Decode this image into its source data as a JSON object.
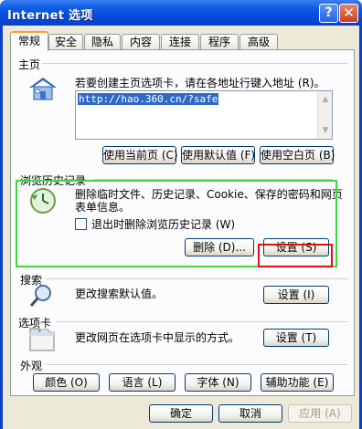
{
  "window": {
    "title": "Internet 选项",
    "help_label": "?",
    "close_label": "✕"
  },
  "tabs": [
    {
      "label": "常规",
      "active": true
    },
    {
      "label": "安全",
      "active": false
    },
    {
      "label": "隐私",
      "active": false
    },
    {
      "label": "内容",
      "active": false
    },
    {
      "label": "连接",
      "active": false
    },
    {
      "label": "程序",
      "active": false
    },
    {
      "label": "高级",
      "active": false
    }
  ],
  "home": {
    "section": "主页",
    "description": "若要创建主页选项卡，请在各地址行键入地址 (R)。",
    "url": "http://hao.360.cn/?safe",
    "buttons": {
      "use_current": "使用当前页 (C)",
      "use_default": "使用默认值 (F)",
      "use_blank": "使用空白页 (B)"
    }
  },
  "history": {
    "section": "浏览历史记录",
    "description_line1": "删除临时文件、历史记录、Cookie、保存的密码和网页",
    "description_line2": "表单信息。",
    "checkbox_label": "退出时删除浏览历史记录 (W)",
    "checkbox_checked": false,
    "delete_label": "删除 (D)...",
    "settings_label": "设置 (S)"
  },
  "search": {
    "section": "搜索",
    "description": "更改搜索默认值。",
    "settings_label": "设置 (I)"
  },
  "tabs_section": {
    "section": "选项卡",
    "description": "更改网页在选项卡中显示的方式。",
    "settings_label": "设置 (T)"
  },
  "appearance": {
    "section": "外观",
    "colors": "颜色 (O)",
    "languages": "语言 (L)",
    "fonts": "字体 (N)",
    "accessibility": "辅助功能 (E)"
  },
  "footer": {
    "ok": "确定",
    "cancel": "取消",
    "apply": "应用 (A)"
  },
  "colors": {
    "titlebar": "#0a5be3",
    "dialog_bg": "#ece9d8",
    "highlight_green": "#3cd93c",
    "highlight_red": "#e01010",
    "selection": "#316ac5"
  }
}
